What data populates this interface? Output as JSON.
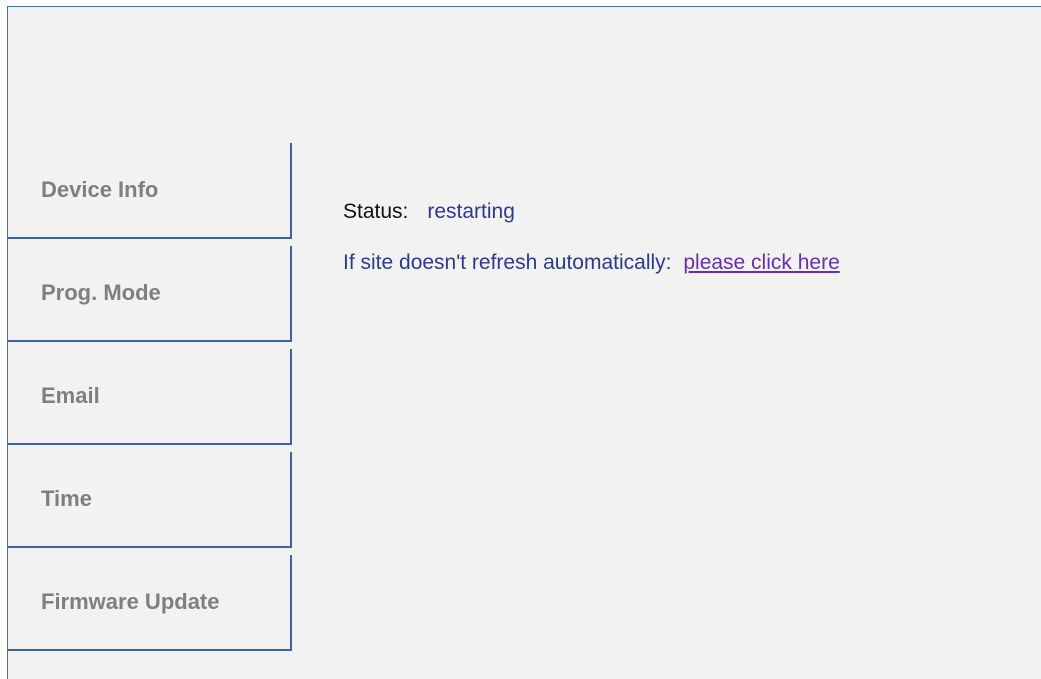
{
  "nav": {
    "items": [
      {
        "label": "Device Info"
      },
      {
        "label": "Prog. Mode"
      },
      {
        "label": "Email"
      },
      {
        "label": "Time"
      },
      {
        "label": "Firmware Update"
      }
    ]
  },
  "main": {
    "status_label": "Status:",
    "status_value": "restarting",
    "refresh_text": "If site doesn't refresh automatically:",
    "refresh_link": "please click here"
  },
  "colors": {
    "frame_border": "#4a6ea8",
    "nav_border": "#3f62a3",
    "nav_text": "#7f7f7f",
    "status_value": "#2d3a8c",
    "link": "#6a2db0",
    "background": "#f2f2f3"
  }
}
